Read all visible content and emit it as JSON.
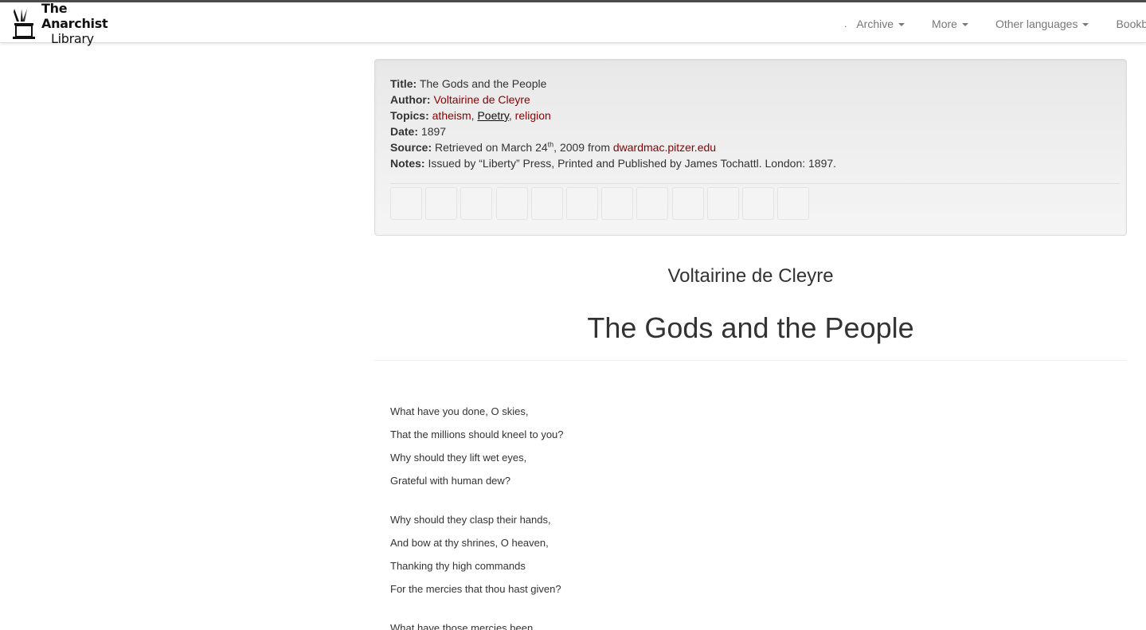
{
  "navbar": {
    "brand_line1": "The Anarchist",
    "brand_line2": "Library",
    "dot": ".",
    "items": [
      {
        "label": "Archive"
      },
      {
        "label": "More"
      },
      {
        "label": "Other languages"
      },
      {
        "label": "Bookbuilder"
      }
    ]
  },
  "meta": {
    "title_label": "Title:",
    "title_value": "The Gods and the People",
    "author_label": "Author:",
    "author_value": "Voltairine de Cleyre",
    "topics_label": "Topics:",
    "topics": [
      "atheism",
      "Poetry",
      "religion"
    ],
    "topic_sep": ",",
    "date_label": "Date:",
    "date_value": "1897",
    "source_label": "Source:",
    "source_prefix": "Retrieved on March 24",
    "source_sup": "th",
    "source_mid": ", 2009 from ",
    "source_link": "dwardmac.pitzer.edu",
    "notes_label": "Notes:",
    "notes_value": "Issued by “Liberty” Press, Printed and Published by James Tochattl. London: 1897.",
    "format_button_count": 12
  },
  "document": {
    "author": "Voltairine de Cleyre",
    "title": "The Gods and the People",
    "stanzas": [
      [
        "What have you done, O skies,",
        "That the millions should kneel to you?",
        "Why should they lift wet eyes,",
        "Grateful with human dew?"
      ],
      [
        "Why should they clasp their hands,",
        "And bow at thy shrines, O heaven,",
        "Thanking thy high commands",
        "For the mercies that thou hast given?"
      ],
      [
        "What have those mercies been,"
      ]
    ]
  },
  "colors": {
    "link": "#8b0000",
    "text": "#333333",
    "nav_text": "#777777",
    "panel_bg": "#eeeeee"
  }
}
